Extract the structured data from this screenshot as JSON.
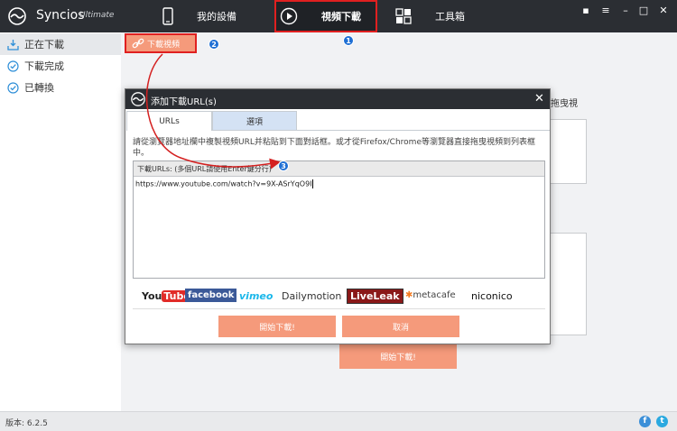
{
  "app": {
    "name": "Syncios",
    "edition": "Ultimate"
  },
  "nav": {
    "devices": "我的設備",
    "video_download": "視頻下載",
    "toolbox": "工具箱"
  },
  "sidebar": {
    "items": [
      {
        "label": "正在下載"
      },
      {
        "label": "下載完成"
      },
      {
        "label": "已轉換"
      }
    ]
  },
  "background": {
    "paste_button": "下載視頻",
    "drag_hint": "拖曳視",
    "start_button": "開始下載!"
  },
  "dialog": {
    "title": "添加下載URL(s)",
    "tabs": [
      "URLs",
      "選項"
    ],
    "hint": "請從瀏覽器地址欄中複製視頻URL并粘貼到下面對話框。或才從Firefox/Chrome等瀏覽器直接拖曳視頻到列表框中。",
    "url_header": "下載URLs: (多個URL請使用Enter鍵分行)",
    "url_value": "https://www.youtube.com/watch?v=9X-ASrYqO9I",
    "sites": [
      "YouTube",
      "facebook",
      "vimeo",
      "Dailymotion",
      "LiveLeak",
      "metacafe",
      "niconico"
    ],
    "start_button": "開始下載!",
    "cancel_button": "取消"
  },
  "badges": [
    "1",
    "2",
    "3"
  ],
  "status": {
    "version": "版本: 6.2.5"
  },
  "colors": {
    "titlebar": "#2b2e33",
    "accent_button": "#f59a7b",
    "highlight": "#e02020",
    "badge": "#1e6fd4"
  }
}
